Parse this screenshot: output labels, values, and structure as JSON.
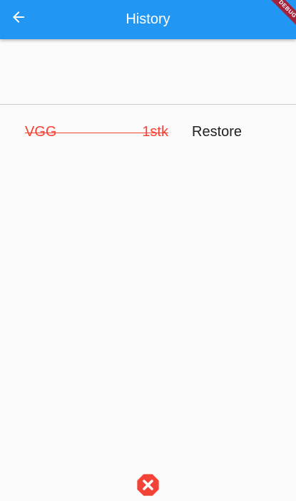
{
  "appbar": {
    "title": "History",
    "back_icon": "arrow-back-icon",
    "color": "#2196f3"
  },
  "debug_banner": {
    "label": "DEBUG",
    "color": "#a4233b"
  },
  "history": {
    "items": [
      {
        "name": "VGG",
        "quantity": "1stk",
        "restore_label": "Restore",
        "struck_through": true,
        "color": "#f44336"
      }
    ]
  },
  "footer": {
    "clear_icon": "close-octagon-icon",
    "clear_color": "#f44336"
  }
}
